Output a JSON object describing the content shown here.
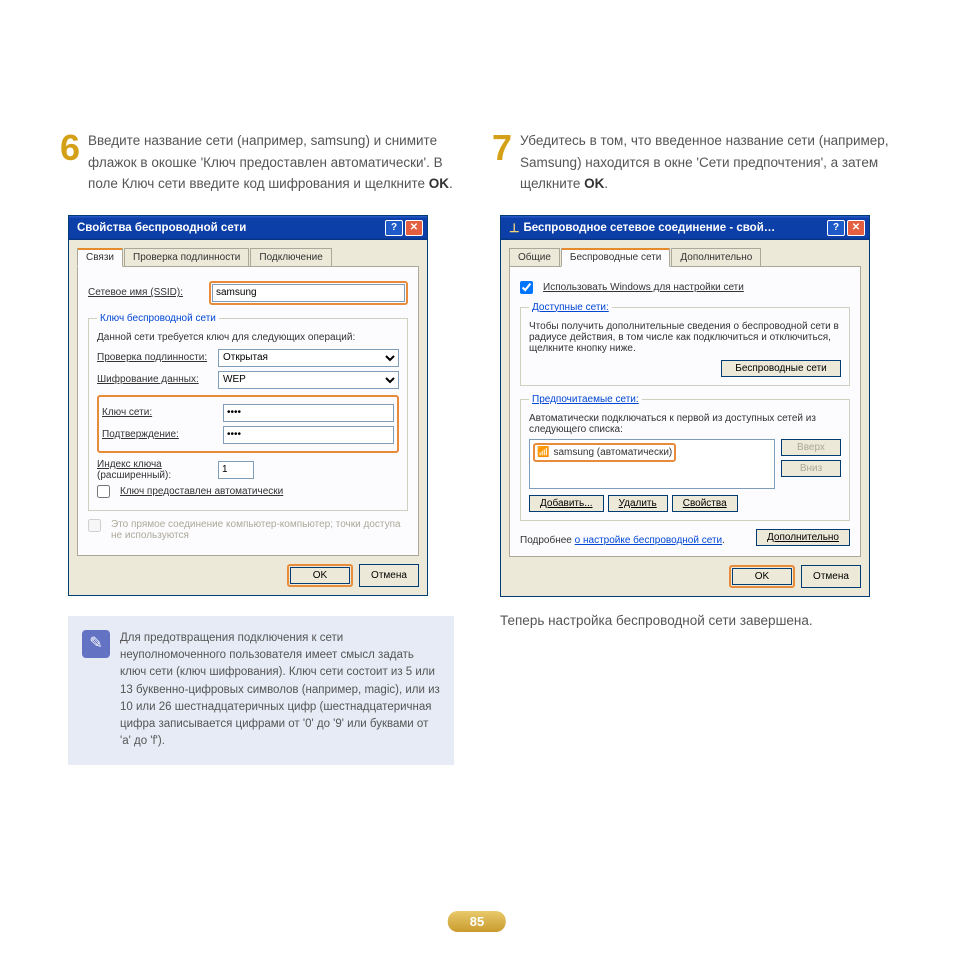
{
  "step6": {
    "num": "6",
    "text_a": "Введите название сети (например, samsung) и снимите флажок в окошке 'Ключ предоставлен автоматически'. В поле Ключ сети введите код шифрования и щелкните ",
    "text_b": "OK",
    "text_c": "."
  },
  "step7": {
    "num": "7",
    "text_a": "Убедитесь в том, что введенное название сети (например, Samsung) находится в окне 'Сети предпочтения', а затем щелкните ",
    "text_b": "OK",
    "text_c": "."
  },
  "dialog1": {
    "title": "Свойства беспроводной сети",
    "tabs": [
      "Связи",
      "Проверка подлинности",
      "Подключение"
    ],
    "ssid_label": "Сетевое имя (SSID):",
    "ssid_value": "samsung",
    "fieldset_legend": "Ключ беспроводной сети",
    "fieldset_text": "Данной сети требуется ключ для следующих операций:",
    "auth_label": "Проверка подлинности:",
    "auth_value": "Открытая",
    "enc_label": "Шифрование данных:",
    "enc_value": "WEP",
    "key_label": "Ключ сети:",
    "key_value": "••••",
    "confirm_label": "Подтверждение:",
    "confirm_value": "••••",
    "index_label_1": "Индекс ключа",
    "index_label_2": "(расширенный):",
    "index_value": "1",
    "auto_key": "Ключ предоставлен автоматически",
    "adhoc": "Это прямое соединение компьютер-компьютер; точки доступа не используются",
    "ok": "OK",
    "cancel": "Отмена"
  },
  "dialog2": {
    "title": "Беспроводное сетевое соединение - свой…",
    "tabs": [
      "Общие",
      "Беспроводные сети",
      "Дополнительно"
    ],
    "use_windows": "Использовать Windows для настройки сети",
    "avail_legend": "Доступные сети:",
    "avail_text": "Чтобы получить дополнительные сведения о беспроводной сети в радиусе действия, в том числе как подключиться и отключиться, щелкните кнопку ниже.",
    "avail_btn": "Беспроводные сети",
    "pref_legend": "Предпочитаемые сети:",
    "pref_text": "Автоматически подключаться к первой из доступных сетей из следующего списка:",
    "net_item": "samsung (автоматически)",
    "up": "Вверх",
    "down": "Вниз",
    "add": "Добавить...",
    "delete": "Удалить",
    "props": "Свойства",
    "more_a": "Подробнее ",
    "more_b": "о настройке беспроводной сети",
    "advanced": "Дополнительно",
    "ok": "OK",
    "cancel": "Отмена"
  },
  "note": "Для предотвращения подключения к сети неуполномоченного пользователя имеет смысл задать ключ сети (ключ шифрования). Ключ сети состоит из 5 или 13 буквенно-цифровых символов (например, magic), или из 10 или 26 шестнадцатеричных цифр (шестнадцатеричная цифра записывается цифрами от '0' до '9' или буквами от 'a' до 'f').",
  "conclusion": "Теперь настройка беспроводной сети завершена.",
  "page_num": "85"
}
